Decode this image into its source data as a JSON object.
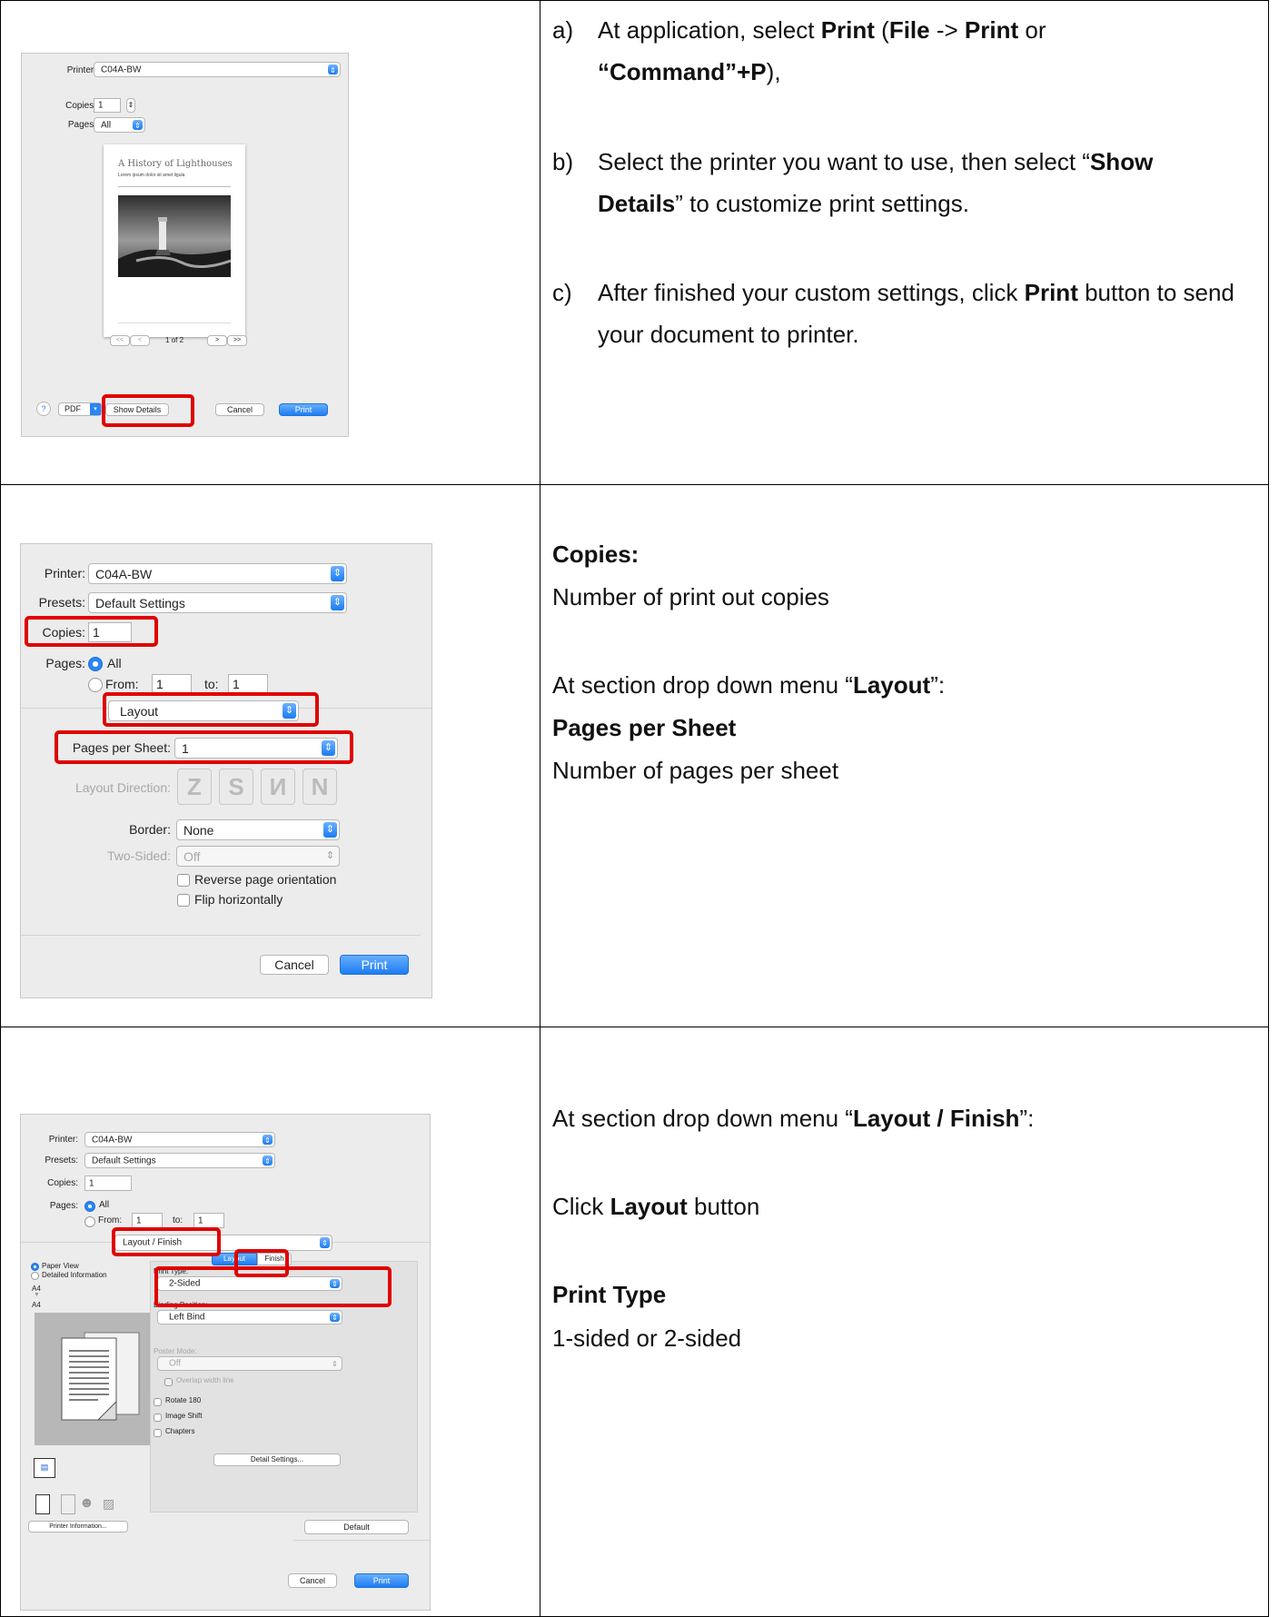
{
  "instructions": {
    "step_a": {
      "marker": "a)",
      "p1": "At application, select ",
      "print": "Print",
      "p2": " (",
      "file": "File",
      "p3": " -> ",
      "print2": "Print",
      "p4": " or",
      "command": "“Command”+P",
      "p5": "),"
    },
    "step_b": {
      "marker": "b)",
      "p1": "Select the printer you want to use, then select “",
      "show_details": "Show Details",
      "p2": "” to customize print settings."
    },
    "step_c": {
      "marker": "c)",
      "p1": "After finished your custom settings, click ",
      "print": "Print",
      "p2": " button to send your document to printer."
    },
    "row2": {
      "copies_heading": "Copies:",
      "copies_desc": "Number of print out copies",
      "section_p1": "At section drop down menu “",
      "section_layout": "Layout",
      "section_p2": "”:",
      "pps_heading": "Pages per Sheet",
      "pps_desc": "Number of pages per sheet"
    },
    "row3": {
      "section_p1": "At section drop down menu “",
      "section_name": "Layout / Finish",
      "section_p2": "”:",
      "click_p1": "Click ",
      "click_layout": "Layout",
      "click_p2": " button",
      "print_type_heading": "Print Type",
      "print_type_desc": "1-sided or 2-sided"
    }
  },
  "dialog1": {
    "printer_label": "Printer:",
    "printer_value": "C04A-BW",
    "copies_label": "Copies:",
    "copies_value": "1",
    "pages_label": "Pages:",
    "pages_value": "All",
    "preview_title": "A History of Lighthouses",
    "preview_subtitle": "Lorem ipsum dolor sit amet ligula",
    "page_indicator": "1 of 2",
    "nav_first": "<<",
    "nav_prev": "<",
    "nav_next": ">",
    "nav_last": ">>",
    "help": "?",
    "pdf": "PDF",
    "show_details": "Show Details",
    "cancel": "Cancel",
    "print": "Print"
  },
  "dialog2": {
    "printer_label": "Printer:",
    "printer_value": "C04A-BW",
    "presets_label": "Presets:",
    "presets_value": "Default Settings",
    "copies_label": "Copies:",
    "copies_value": "1",
    "pages_label": "Pages:",
    "pages_all": "All",
    "pages_from": "From:",
    "from_value": "1",
    "to_label": "to:",
    "to_value": "1",
    "section_value": "Layout",
    "pps_label": "Pages per Sheet:",
    "pps_value": "1",
    "layout_direction_label": "Layout Direction:",
    "border_label": "Border:",
    "border_value": "None",
    "two_sided_label": "Two-Sided:",
    "two_sided_value": "Off",
    "reverse_label": "Reverse page orientation",
    "flip_label": "Flip horizontally",
    "cancel": "Cancel",
    "print": "Print"
  },
  "dialog3": {
    "printer_label": "Printer:",
    "printer_value": "C04A-BW",
    "presets_label": "Presets:",
    "presets_value": "Default Settings",
    "copies_label": "Copies:",
    "copies_value": "1",
    "pages_label": "Pages:",
    "pages_all": "All",
    "pages_from": "From:",
    "from_value": "1",
    "to_label": "to:",
    "to_value": "1",
    "section_value": "Layout / Finish",
    "paper_view": "Paper View",
    "detailed_information": "Detailed Information",
    "paper_a": "A4",
    "paper_b": "A4",
    "tab_layout": "Layout",
    "tab_finish": "Finish",
    "print_type_label": "Print Type:",
    "print_type_value": "2-Sided",
    "binding_label": "Binding Position:",
    "binding_value": "Left Bind",
    "poster_label": "Poster Mode:",
    "poster_value": "Off",
    "overlap_label": "Overlap width line",
    "rotate_label": "Rotate 180",
    "image_shift_label": "Image Shift",
    "chapters_label": "Chapters",
    "detail_settings": "Detail Settings...",
    "printer_information": "Printer Information...",
    "default": "Default",
    "cancel": "Cancel",
    "print": "Print"
  },
  "colors": {
    "highlight": "#e00000",
    "accent_blue": "#1d7df3",
    "border": "#000000"
  }
}
